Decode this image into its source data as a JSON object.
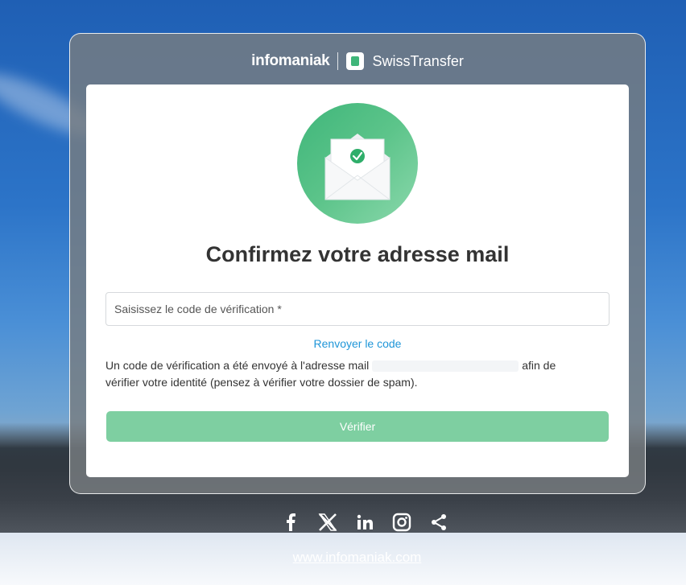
{
  "brand": {
    "company": "infomaniak",
    "product": "SwissTransfer"
  },
  "page": {
    "title": "Confirmez votre adresse mail",
    "verification_placeholder": "Saisissez le code de vérification *",
    "resend_label": "Renvoyer le code",
    "info_prefix": "Un code de vérification a été envoyé à l'adresse mail",
    "info_suffix_1": "afin de",
    "info_suffix_2": "vérifier votre identité (pensez à vérifier votre dossier de spam).",
    "verify_label": "Vérifier"
  },
  "footer": {
    "social_icons": [
      "facebook-icon",
      "x-icon",
      "linkedin-icon",
      "instagram-icon",
      "share-icon"
    ],
    "website": "www.infomaniak.com"
  },
  "colors": {
    "accent": "#3fb67a",
    "button_disabled": "#7ecfa1",
    "link": "#1f96d8"
  }
}
